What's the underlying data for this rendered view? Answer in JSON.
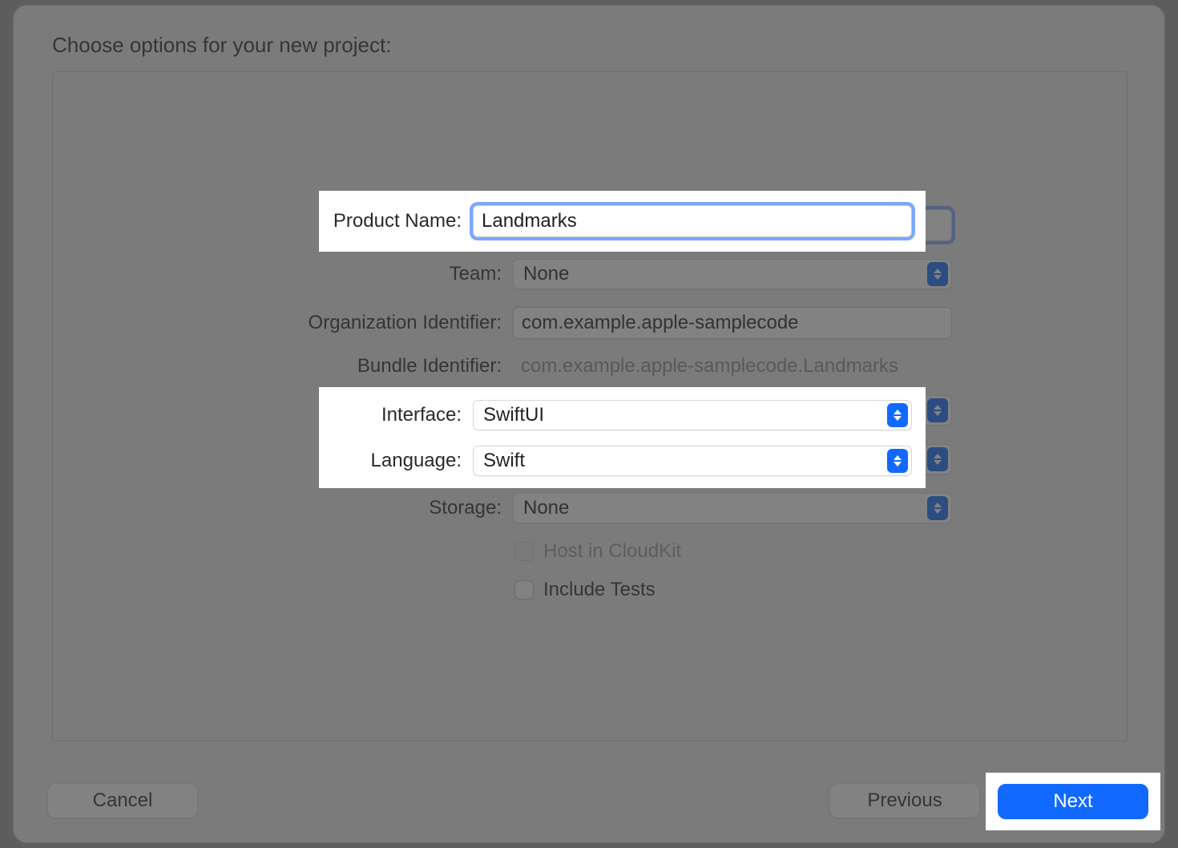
{
  "sheet": {
    "title": "Choose options for your new project:"
  },
  "form": {
    "product_name": {
      "label": "Product Name:",
      "value": "Landmarks"
    },
    "team": {
      "label": "Team:",
      "value": "None"
    },
    "org_id": {
      "label": "Organization Identifier:",
      "value": "com.example.apple-samplecode"
    },
    "bundle_id": {
      "label": "Bundle Identifier:",
      "value": "com.example.apple-samplecode.Landmarks"
    },
    "interface": {
      "label": "Interface:",
      "value": "SwiftUI"
    },
    "language": {
      "label": "Language:",
      "value": "Swift"
    },
    "storage": {
      "label": "Storage:",
      "value": "None"
    },
    "cloudkit": {
      "label": "Host in CloudKit",
      "checked": false,
      "enabled": false
    },
    "tests": {
      "label": "Include Tests",
      "checked": false,
      "enabled": true
    }
  },
  "footer": {
    "cancel": "Cancel",
    "previous": "Previous",
    "next": "Next"
  }
}
